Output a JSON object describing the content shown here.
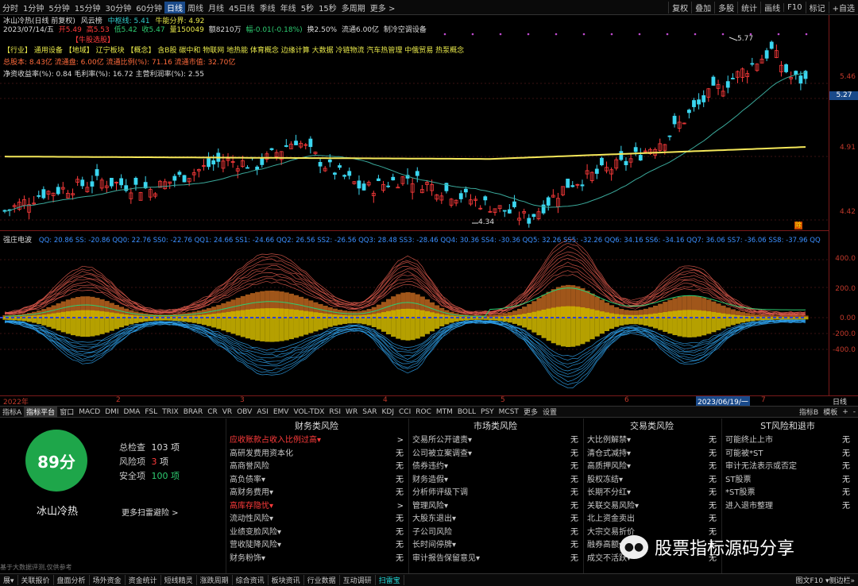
{
  "topbar": {
    "timeframes": [
      "分时",
      "1分钟",
      "5分钟",
      "15分钟",
      "30分钟",
      "60分钟",
      "日线",
      "周线",
      "月线",
      "45日线",
      "季线",
      "年线",
      "5秒",
      "15秒",
      "多周期",
      "更多 >"
    ],
    "active_tf": "日线",
    "tools": [
      "复权",
      "叠加",
      "多股",
      "统计",
      "画线",
      "F10",
      "标记",
      "+自选"
    ]
  },
  "header": {
    "title": "冰山冷热(日线 前复权)",
    "indicator": "风云榜",
    "mid": "中枢线: 5.41",
    "energy": "牛能分界: 4.92",
    "date": "2023/07/14/五",
    "open": "开5.49",
    "high": "高5.53",
    "low": "低5.42",
    "close": "收5.47",
    "vol": "量150049",
    "amount": "额8210万",
    "change": "幅-0.01(-0.18%)",
    "turnover": "换2.50%",
    "float": "流通6.00亿",
    "concept": "制冷空调设备",
    "badge": "【牛股选股】",
    "sector_line": "【行业】 通用设备 【地域】 辽宁板块 【概念】 含B股 碳中和 物联网 地热能 体育概念 边缘计算 大数据 冷链物流 汽车热管理 中俄贸易 热泵概念",
    "cap_line": "总股本: 8.43亿 流通盘: 6.00亿 流通比例(%): 71.16 流通市值: 32.70亿",
    "ratio_line": "净资收益率(%): 0.84 毛利率(%): 16.72 主营利润率(%): 2.55"
  },
  "price_axis": {
    "labels": [
      "5.46",
      "5.27",
      "4.91",
      "4.42"
    ],
    "current": "5.27"
  },
  "chart_marks": {
    "high": "5.77",
    "low": "4.34",
    "flag1": "财",
    "flag2": "除"
  },
  "sub": {
    "name": "强庄电波",
    "legend": "QQ: 20.86  SS: -20.86  QQ0: 22.76  SS0: -22.76  QQ1: 24.66  SS1: -24.66  QQ2: 26.56  SS2: -26.56  QQ3: 28.48  SS3: -28.46  QQ4: 30.36  SS4: -30.36  QQ5: 32.26  SS5: -32.26  QQ6: 34.16  SS6: -34.16  QQ7: 36.06  SS7: -36.06  SS8: -37.96  QQ",
    "axis": [
      "400.0",
      "200.0",
      "0.00",
      "-200.0",
      "-400.0"
    ]
  },
  "xaxis": {
    "year": "2022年",
    "m2": "2",
    "m3": "3",
    "m4": "4",
    "m5": "5",
    "m6": "6",
    "date": "2023/06/19/一",
    "m7": "7",
    "right": "日线"
  },
  "tabs": [
    "指标A",
    "指标平台",
    "窗口",
    "MACD",
    "DMI",
    "DMA",
    "FSL",
    "TRIX",
    "BRAR",
    "CR",
    "VR",
    "OBV",
    "ASI",
    "EMV",
    "VOL-TDX",
    "RSI",
    "WR",
    "SAR",
    "KDJ",
    "CCI",
    "ROC",
    "MTM",
    "BOLL",
    "PSY",
    "MCST",
    "更多",
    "设置"
  ],
  "tabs_right": [
    "指标B",
    "模板",
    "+",
    "-"
  ],
  "score": {
    "value": "89分",
    "name": "冰山冷热",
    "total_label": "总检查",
    "total": "103 项",
    "risk_label": "风险项",
    "risk": "3",
    "risk_unit": "项",
    "safe_label": "安全项",
    "safe": "100 项",
    "more": "更多扫雷避险 >",
    "footer": "基于大数据评测,仅供参考"
  },
  "finance": {
    "title": "财务类风险",
    "rows": [
      [
        "应收账款占收入比例过高▾",
        ">",
        1
      ],
      [
        "高研发费用资本化",
        "无",
        0
      ],
      [
        "高商誉风险",
        "无",
        0
      ],
      [
        "高负债率▾",
        "无",
        0
      ],
      [
        "高财务费用▾",
        "无",
        0
      ],
      [
        "高库存隐忧▾",
        ">",
        1
      ],
      [
        "流动性风险▾",
        "无",
        0
      ],
      [
        "业绩变脸风险▾",
        "无",
        0
      ],
      [
        "营收陡降风险▾",
        "无",
        0
      ],
      [
        "财务粉饰▾",
        "无",
        0
      ]
    ]
  },
  "market": {
    "title": "市场类风险",
    "rows": [
      [
        "交易所公开谴责▾",
        "无"
      ],
      [
        "公司被立案调查▾",
        "无"
      ],
      [
        "债券违约▾",
        "无"
      ],
      [
        "财务造假▾",
        "无"
      ],
      [
        "分析师评级下调",
        "无"
      ],
      [
        "管理风险▾",
        "无"
      ],
      [
        "大股东退出▾",
        "无"
      ],
      [
        "子公司风险",
        "无"
      ],
      [
        "长时间停牌▾",
        "无"
      ],
      [
        "审计报告保留意见▾",
        "无"
      ]
    ]
  },
  "trade": {
    "title": "交易类风险",
    "rows": [
      [
        "大比例解禁▾",
        "无"
      ],
      [
        "清仓式减持▾",
        "无"
      ],
      [
        "高质押风险▾",
        "无"
      ],
      [
        "股权冻结▾",
        "无"
      ],
      [
        "长期不分红▾",
        "无"
      ],
      [
        "关联交易风险▾",
        "无"
      ],
      [
        "北上资金卖出",
        "无"
      ],
      [
        "大宗交易折价",
        "无"
      ],
      [
        "融券高额▾",
        "无"
      ],
      [
        "成交不活跃▾",
        "无"
      ]
    ]
  },
  "st": {
    "title": "ST风险和退市",
    "rows": [
      [
        "可能终止上市",
        "无"
      ],
      [
        "可能被*ST",
        "无"
      ],
      [
        "审计无法表示或否定",
        "无"
      ],
      [
        "ST股票",
        "无"
      ],
      [
        "*ST股票",
        "无"
      ],
      [
        "进入退市整理",
        "无"
      ]
    ]
  },
  "watermark": "股票指标源码分享",
  "status": [
    "展▾",
    "关联报价",
    "盘面分析",
    "场外资金",
    "资金统计",
    "短线精灵",
    "涨跌周期",
    "综合资讯",
    "板块资讯",
    "行业数据",
    "互动调研",
    "扫雷宝"
  ],
  "status_active": "扫雷宝",
  "status_right": "图文F10 ▾侧边栏»"
}
